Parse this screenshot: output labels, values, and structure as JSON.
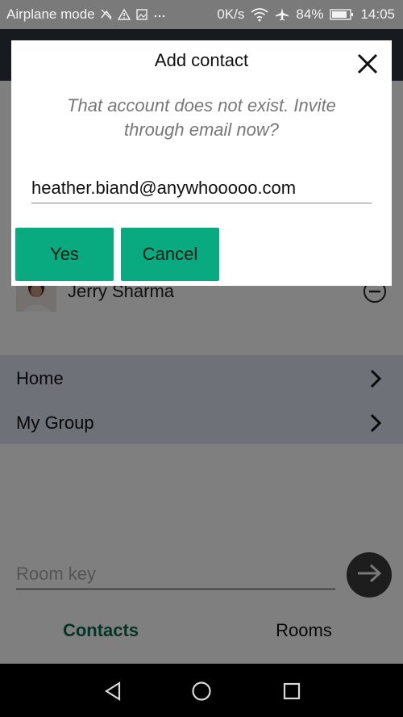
{
  "status_bar": {
    "mode": "Airplane mode",
    "speed": "0K/s",
    "battery": "84%",
    "time": "14:05",
    "icons": [
      "network-icon",
      "alert-icon",
      "image-icon",
      "more-icon",
      "wifi-icon",
      "airplane-icon",
      "battery-icon"
    ]
  },
  "contacts": [
    {
      "name": "Jerry Sharma"
    }
  ],
  "groups": [
    {
      "label": "Home"
    },
    {
      "label": "My Group"
    }
  ],
  "room_key": {
    "placeholder": "Room key"
  },
  "tabs": [
    {
      "label": "Contacts",
      "active": true
    },
    {
      "label": "Rooms",
      "active": false
    }
  ],
  "dialog": {
    "title": "Add contact",
    "message": "That account does not exist.  Invite through email now?",
    "email": "heather.biand@anywhooooo.com",
    "yes_label": "Yes",
    "cancel_label": "Cancel"
  },
  "colors": {
    "accent": "#0aaa80",
    "active_tab": "#0a6b4e",
    "header": "#2f3640",
    "group_band": "#dde4f0"
  }
}
